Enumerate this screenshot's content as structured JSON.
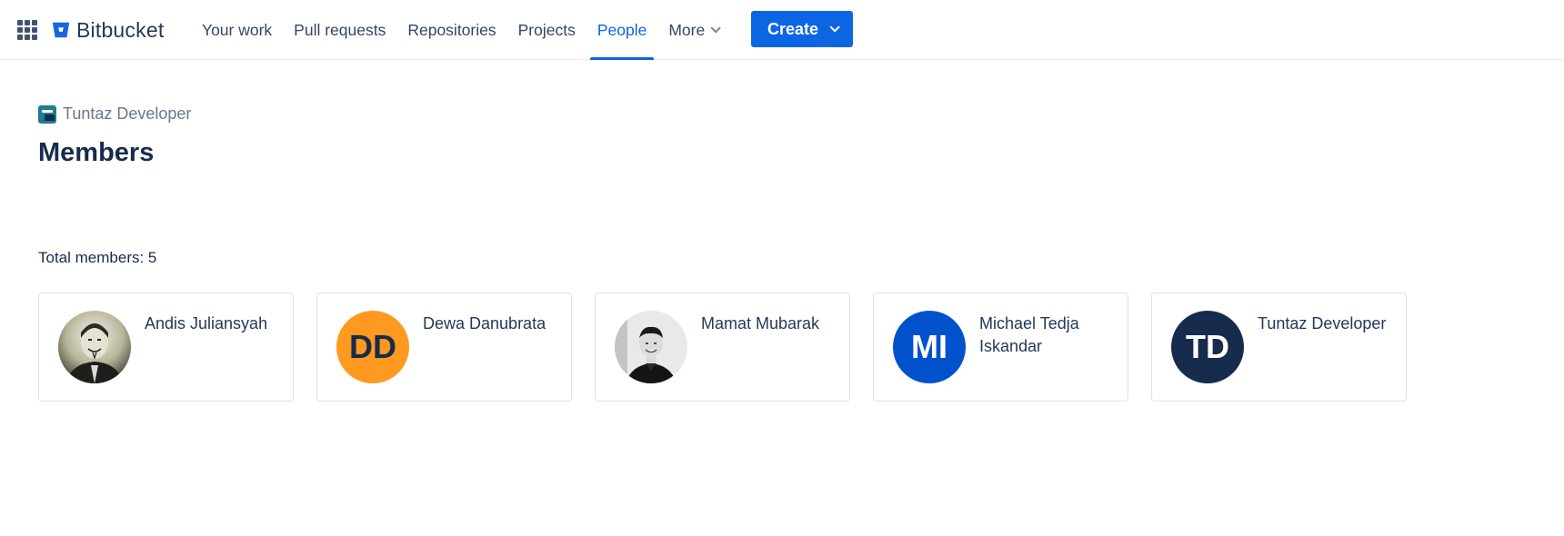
{
  "header": {
    "brand": "Bitbucket",
    "nav": [
      {
        "label": "Your work",
        "active": false
      },
      {
        "label": "Pull requests",
        "active": false
      },
      {
        "label": "Repositories",
        "active": false
      },
      {
        "label": "Projects",
        "active": false
      },
      {
        "label": "People",
        "active": true
      },
      {
        "label": "More",
        "active": false
      }
    ],
    "create_label": "Create"
  },
  "breadcrumb": {
    "workspace": "Tuntaz Developer"
  },
  "page": {
    "title": "Members",
    "total_label": "Total members: 5"
  },
  "members": [
    {
      "name": "Andis Juliansyah",
      "initials": "",
      "avatar_type": "photo-mask"
    },
    {
      "name": "Dewa Danubrata",
      "initials": "DD",
      "avatar_type": "initials",
      "bg": "#ff991f",
      "fg": "#172b4d"
    },
    {
      "name": "Mamat Mubarak",
      "initials": "",
      "avatar_type": "photo-person"
    },
    {
      "name": "Michael Tedja Iskandar",
      "initials": "MI",
      "avatar_type": "initials",
      "bg": "#0052cc",
      "fg": "#ffffff"
    },
    {
      "name": "Tuntaz Developer",
      "initials": "TD",
      "avatar_type": "initials",
      "bg": "#172b4d",
      "fg": "#ffffff"
    }
  ],
  "colors": {
    "accent": "#0c66e4",
    "text": "#172b4d",
    "muted": "#6b778c"
  }
}
